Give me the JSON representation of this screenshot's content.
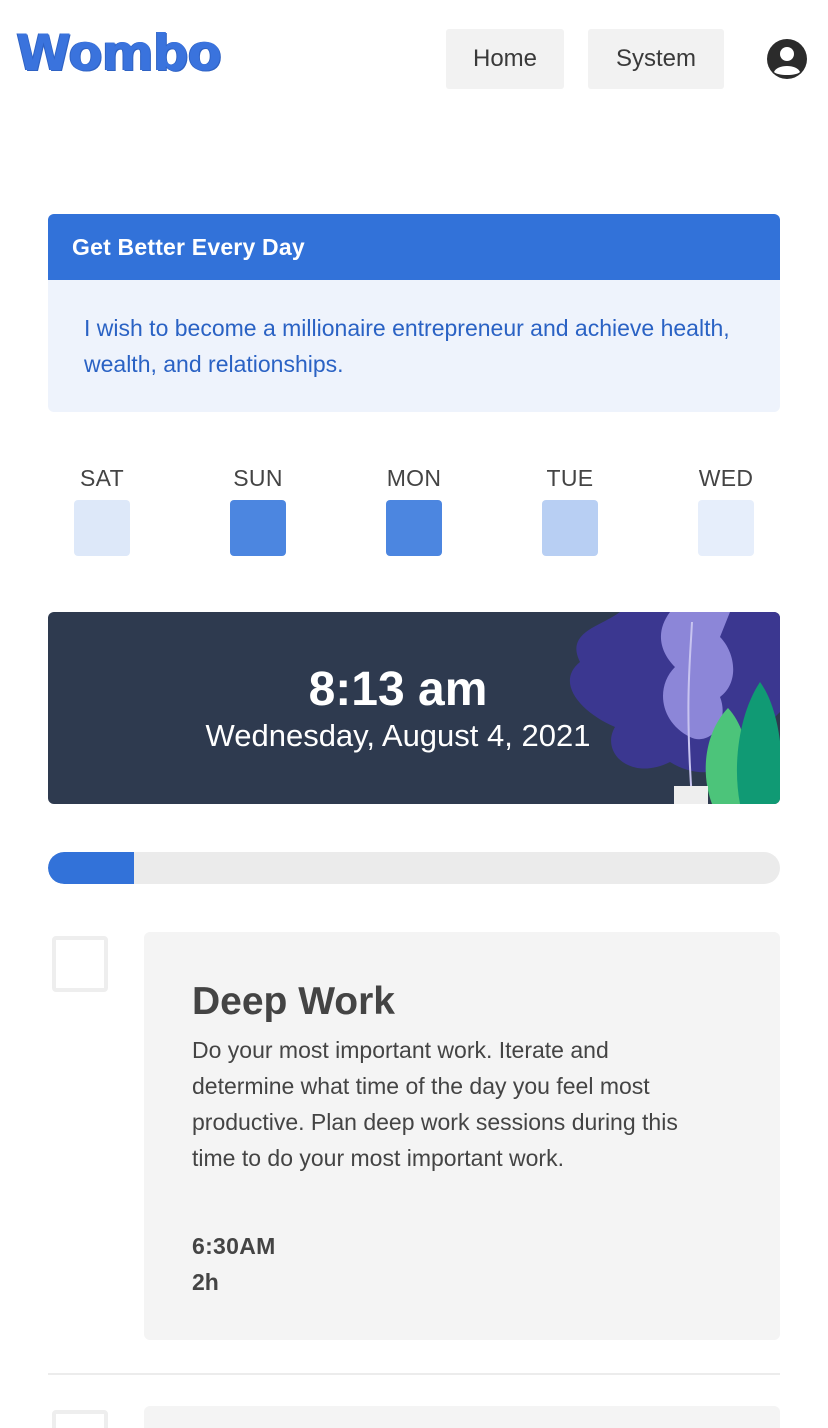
{
  "header": {
    "logo": "Wombo",
    "nav": [
      {
        "label": "Home"
      },
      {
        "label": "System"
      }
    ],
    "account_icon": "user-circle-icon"
  },
  "goal": {
    "title": "Get Better Every Day",
    "text": "I wish to become a millionaire entrepreneur and achieve health, wealth, and relationships."
  },
  "week": [
    {
      "label": "SAT",
      "color": "#dde8f9"
    },
    {
      "label": "SUN",
      "color": "#4c86e0"
    },
    {
      "label": "MON",
      "color": "#4c86e0"
    },
    {
      "label": "TUE",
      "color": "#b8cff3"
    },
    {
      "label": "WED",
      "color": "#e6eefb"
    }
  ],
  "clock": {
    "time": "8:13 am",
    "date": "Wednesday, August 4, 2021"
  },
  "progress": {
    "fraction": 0.117
  },
  "tasks": [
    {
      "title": "Deep Work",
      "description": "Do your most important work. Iterate and determine what time of the day you feel most productive. Plan deep work sessions during this time to do your most important work.",
      "time": "6:30AM",
      "duration": "2h",
      "completed": false
    }
  ],
  "colors": {
    "accent": "#3272d9",
    "banner_bg": "#2e3a4f"
  }
}
